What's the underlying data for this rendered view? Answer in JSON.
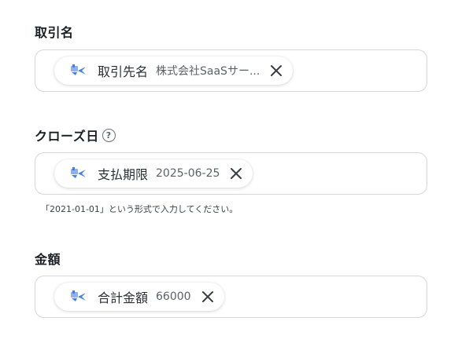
{
  "fields": [
    {
      "label": "取引名",
      "chip": {
        "name": "取引先名",
        "value": "株式会社SaaSサー..."
      }
    },
    {
      "label": "クローズ日",
      "help_icon": "?",
      "chip": {
        "name": "支払期限",
        "value": "2025-06-25"
      },
      "hint": "「2021-01-01」という形式で入力してください。"
    },
    {
      "label": "金額",
      "chip": {
        "name": "合計金額",
        "value": "66000"
      }
    }
  ],
  "icons": {
    "chip_icon": "app-logo-icon",
    "close_icon": "close-icon",
    "help_icon": "question-circle-icon"
  },
  "colors": {
    "chip_icon_blue": "#4a7fd6",
    "border": "#d3d6db"
  }
}
